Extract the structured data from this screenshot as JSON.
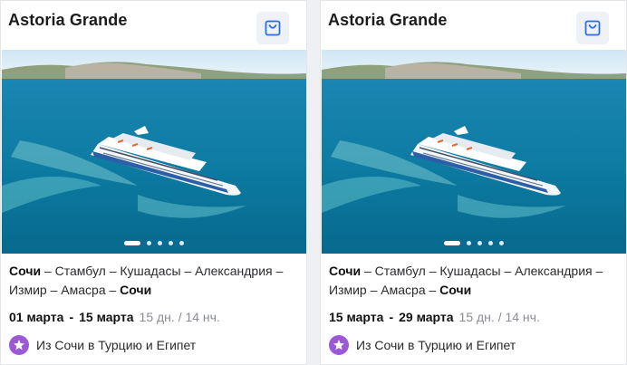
{
  "cards": [
    {
      "title": "Astoria Grande",
      "route_start": "Сочи",
      "route_middle": " – Стамбул – Кушадасы – Александрия – Измир – Амасра – ",
      "route_end": "Сочи",
      "date_from": "01 марта",
      "date_sep": "-",
      "date_to": "15 марта",
      "duration": "15 дн. / 14 нч.",
      "promo": "Из Сочи в Турцию и Египет",
      "slides": 5,
      "active_slide": 0
    },
    {
      "title": "Astoria Grande",
      "route_start": "Сочи",
      "route_middle": " – Стамбул – Кушадасы – Александрия – Измир – Амасра – ",
      "route_end": "Сочи",
      "date_from": "15 марта",
      "date_sep": "-",
      "date_to": "29 марта",
      "duration": "15 дн. / 14 нч.",
      "promo": "Из Сочи в Турцию и Египет",
      "slides": 5,
      "active_slide": 0
    }
  ],
  "icons": {
    "favorite": "shopping-bag-icon",
    "promo": "star-icon"
  },
  "colors": {
    "accent": "#2b6ee0",
    "promo_badge": "#9b59d6",
    "duration_text": "#8a8d93"
  }
}
